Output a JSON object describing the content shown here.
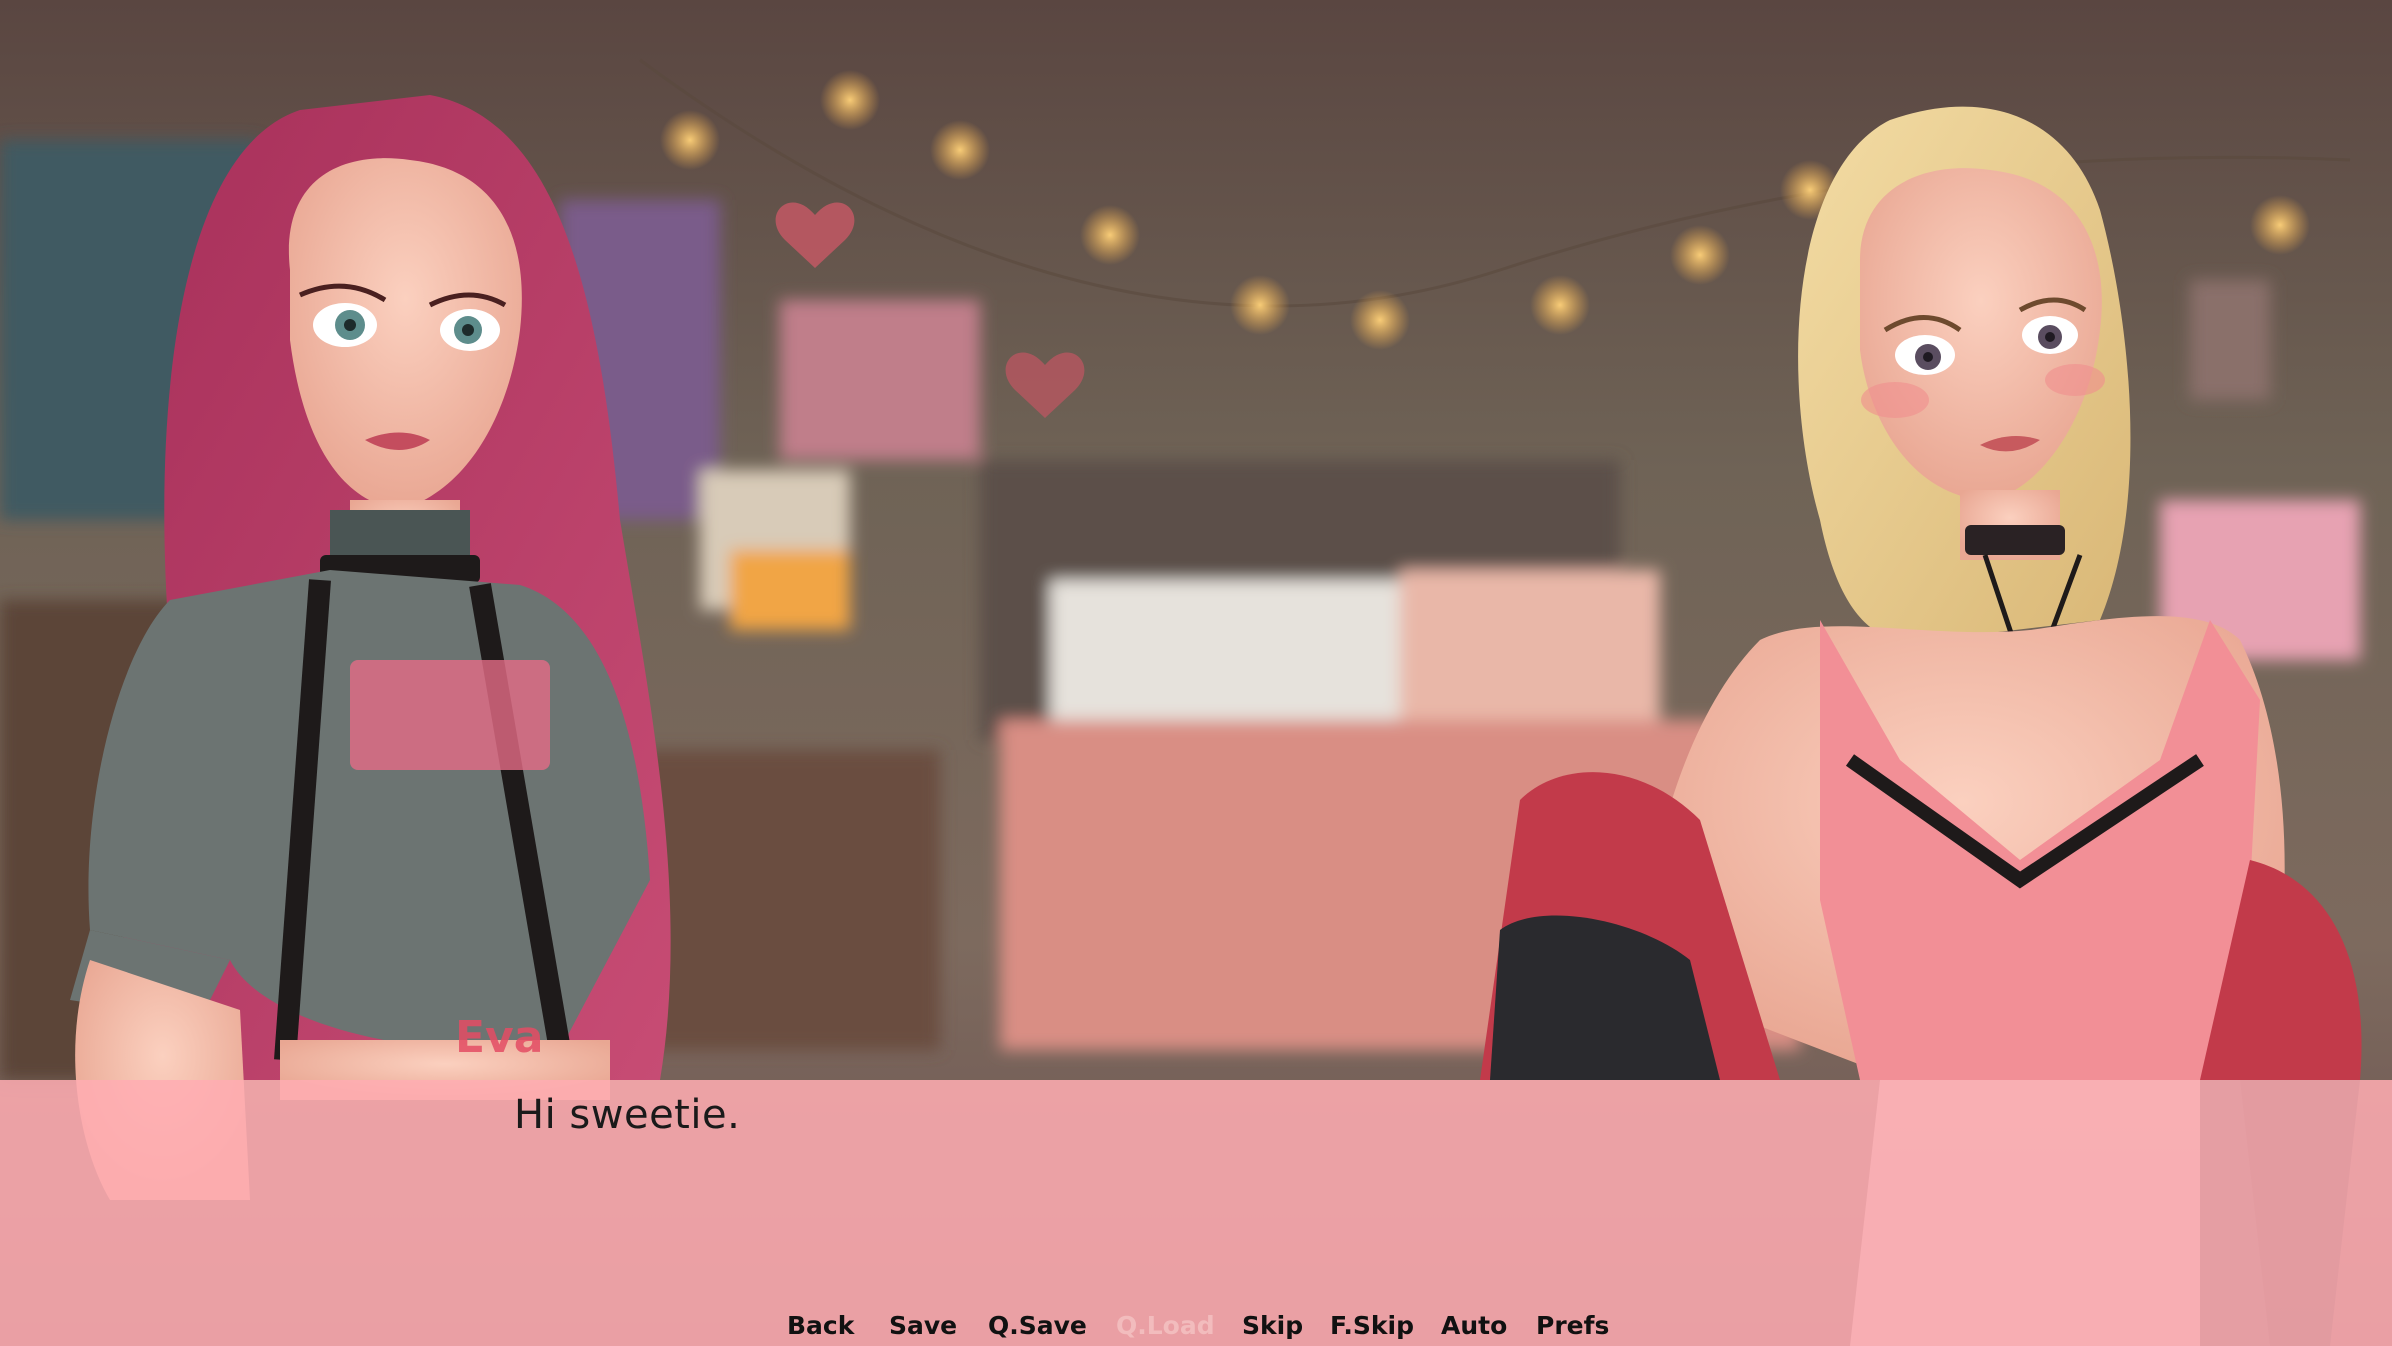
{
  "dialogue": {
    "speaker_nameplate_text": "Eva",
    "text": "Hi sweetie."
  },
  "quick_menu": {
    "back": "Back",
    "save": "Save",
    "q_save": "Q.Save",
    "q_load": "Q.Load",
    "skip": "Skip",
    "f_skip": "F.Skip",
    "auto": "Auto",
    "prefs": "Prefs"
  },
  "colors": {
    "dialogue_box": "#ffacb2",
    "text": "#1a1a1a",
    "disabled": "#f2bcbd"
  }
}
